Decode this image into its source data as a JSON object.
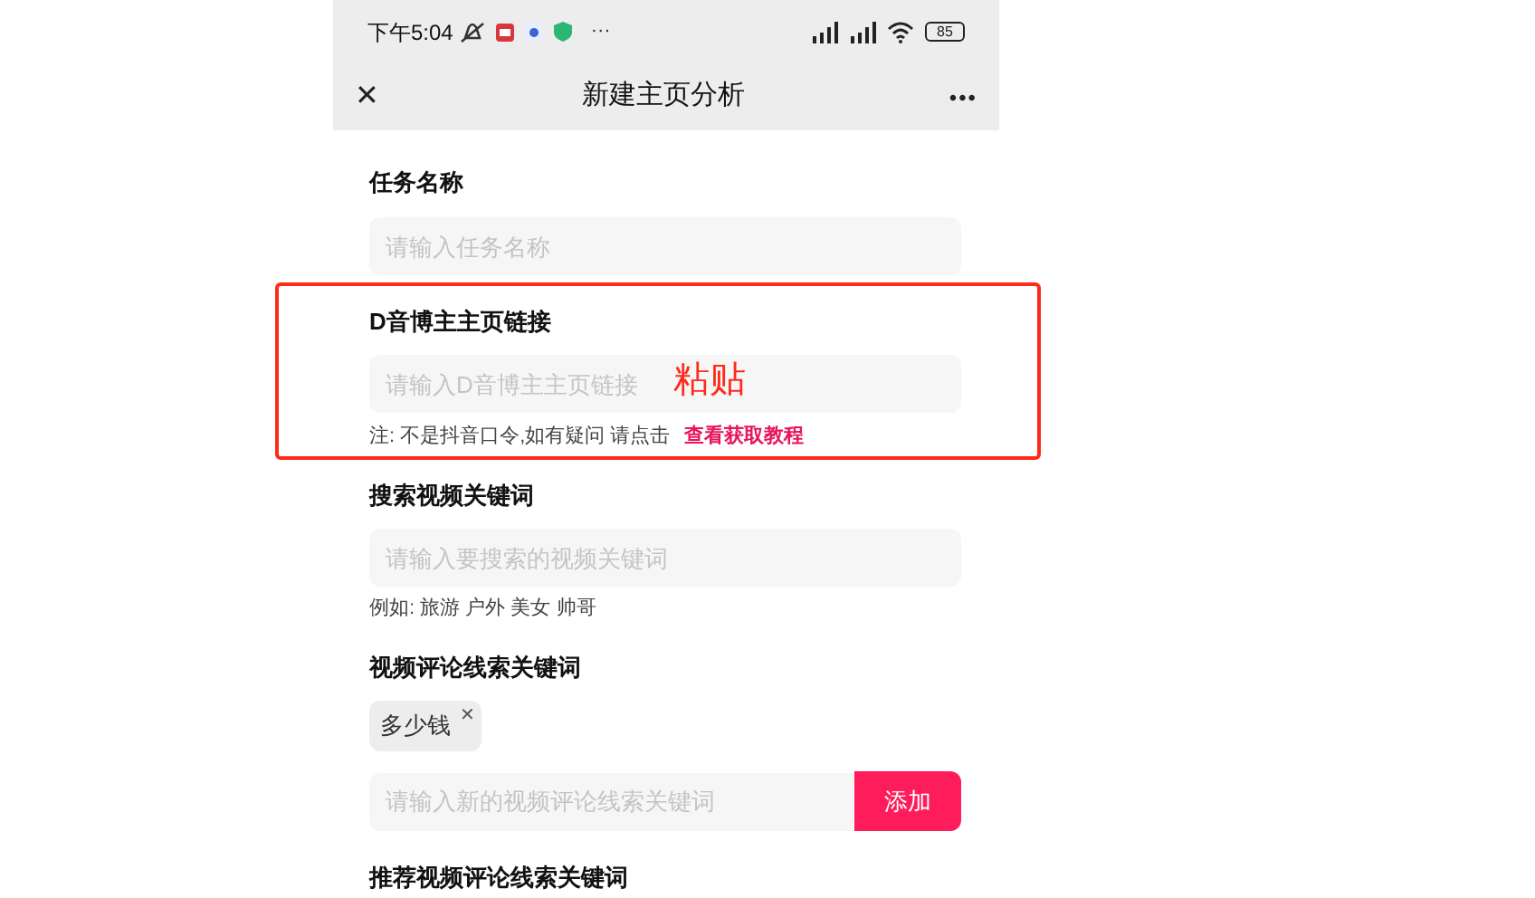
{
  "status_bar": {
    "time": "下午5:04",
    "more": "···",
    "battery": "85"
  },
  "nav": {
    "close": "✕",
    "title": "新建主页分析",
    "more": "•••"
  },
  "sections": [
    {
      "kind": "text",
      "label": "任务名称",
      "placeholder": "请输入任务名称"
    },
    {
      "kind": "link",
      "label": "D音博主主页链接",
      "placeholder": "请输入D音博主主页链接",
      "note": "注: 不是抖音口令,如有疑问 请点击",
      "link": "查看获取教程",
      "annotation": "粘贴"
    },
    {
      "kind": "hint",
      "label": "搜索视频关键词",
      "placeholder": "请输入要搜索的视频关键词",
      "hint": "例如: 旅游 户外 美女 帅哥"
    },
    {
      "kind": "tags",
      "label": "视频评论线索关键词",
      "tags": [
        {
          "text": "多少钱",
          "remove": "✕"
        }
      ],
      "placeholder": "请输入新的视频评论线索关键词",
      "button": "添加"
    },
    {
      "kind": "label",
      "label": "推荐视频评论线索关键词"
    }
  ]
}
